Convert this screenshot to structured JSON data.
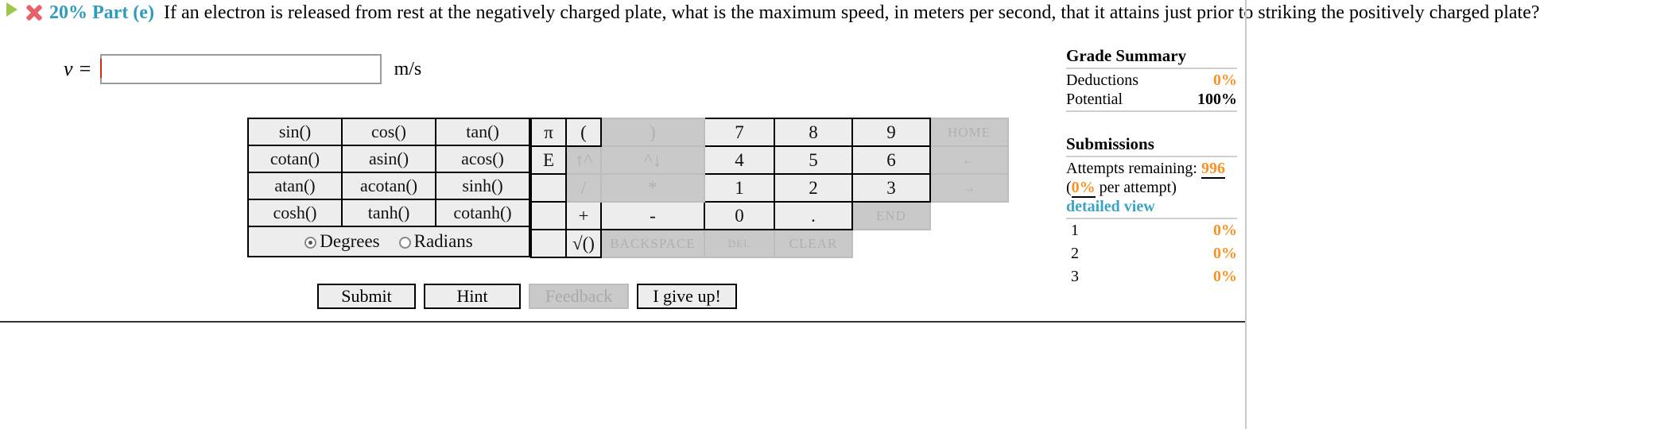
{
  "question": {
    "status_icons": [
      "play-triangle-icon",
      "red-x-icon"
    ],
    "part_label": "20% Part (e)",
    "text": "If an electron is released from rest at the negatively charged plate, what is the maximum speed, in meters per second, that it attains just prior to striking the positively charged plate?"
  },
  "answer": {
    "variable": "v =",
    "value": "",
    "placeholder": "",
    "unit": "m/s"
  },
  "calculator": {
    "functions": [
      [
        "sin()",
        "cos()",
        "tan()"
      ],
      [
        "cotan()",
        "asin()",
        "acos()"
      ],
      [
        "atan()",
        "acotan()",
        "sinh()"
      ],
      [
        "cosh()",
        "tanh()",
        "cotanh()"
      ]
    ],
    "angle_mode": {
      "selected": "Degrees",
      "options": [
        "Degrees",
        "Radians"
      ]
    },
    "keypad_rows": [
      [
        {
          "label": "π",
          "kind": "active",
          "name": "pi"
        },
        {
          "label": "(",
          "kind": "active",
          "name": "open-paren"
        },
        {
          "label": ")",
          "kind": "disabled",
          "name": "close-paren"
        },
        {
          "label": "7",
          "kind": "active",
          "name": "digit-7"
        },
        {
          "label": "8",
          "kind": "active",
          "name": "digit-8"
        },
        {
          "label": "9",
          "kind": "active",
          "name": "digit-9"
        },
        {
          "label": "HOME",
          "kind": "disabled",
          "name": "home"
        }
      ],
      [
        {
          "label": "E",
          "kind": "active",
          "name": "exponent-e"
        },
        {
          "label": "↑^",
          "kind": "disabled",
          "name": "power-up"
        },
        {
          "label": "^↓",
          "kind": "disabled",
          "name": "power-down"
        },
        {
          "label": "4",
          "kind": "active",
          "name": "digit-4"
        },
        {
          "label": "5",
          "kind": "active",
          "name": "digit-5"
        },
        {
          "label": "6",
          "kind": "active",
          "name": "digit-6"
        },
        {
          "label": "←",
          "kind": "disabled",
          "name": "cursor-left"
        }
      ],
      [
        {
          "label": "",
          "kind": "blank",
          "name": "spacer"
        },
        {
          "label": "/",
          "kind": "disabled",
          "name": "divide"
        },
        {
          "label": "*",
          "kind": "disabled",
          "name": "multiply"
        },
        {
          "label": "1",
          "kind": "active",
          "name": "digit-1"
        },
        {
          "label": "2",
          "kind": "active",
          "name": "digit-2"
        },
        {
          "label": "3",
          "kind": "active",
          "name": "digit-3"
        },
        {
          "label": "→",
          "kind": "disabled",
          "name": "cursor-right"
        }
      ],
      [
        {
          "label": "",
          "kind": "blank",
          "name": "spacer"
        },
        {
          "label": "+",
          "kind": "active",
          "name": "plus"
        },
        {
          "label": "-",
          "kind": "active",
          "name": "minus"
        },
        {
          "label": "0",
          "kind": "active",
          "name": "digit-0",
          "wide": true
        },
        {
          "label": ".",
          "kind": "active",
          "name": "decimal-point"
        },
        {
          "label": "END",
          "kind": "disabled",
          "name": "end"
        }
      ],
      [
        {
          "label": "",
          "kind": "blank",
          "name": "spacer"
        },
        {
          "label": "√()",
          "kind": "active",
          "name": "square-root"
        },
        {
          "label": "BACKSPACE",
          "kind": "disabled",
          "name": "backspace"
        },
        {
          "label": "DEL",
          "kind": "disabled",
          "name": "delete"
        },
        {
          "label": "CLEAR",
          "kind": "disabled",
          "name": "clear"
        }
      ]
    ]
  },
  "actions": {
    "submit": "Submit",
    "hint": "Hint",
    "feedback": "Feedback",
    "give_up": "I give up!"
  },
  "grade_summary": {
    "title": "Grade Summary",
    "deductions_label": "Deductions",
    "deductions_value": "0%",
    "potential_label": "Potential",
    "potential_value": "100%"
  },
  "submissions": {
    "title": "Submissions",
    "attempts_label": "Attempts remaining:",
    "attempts_value": "996",
    "per_attempt_prefix": "(",
    "per_attempt_value": "0%",
    "per_attempt_suffix": " per attempt)",
    "detailed_view": "detailed view",
    "rows": [
      {
        "num": "1",
        "pct": "0%"
      },
      {
        "num": "2",
        "pct": "0%"
      },
      {
        "num": "3",
        "pct": "0%"
      }
    ]
  },
  "colors": {
    "accent_blue": "#2d9bbd",
    "orange": "#f79226",
    "link_blue": "#3ba3c4",
    "red_x": "#e8606a",
    "green_triangle": "#9ec84a"
  }
}
